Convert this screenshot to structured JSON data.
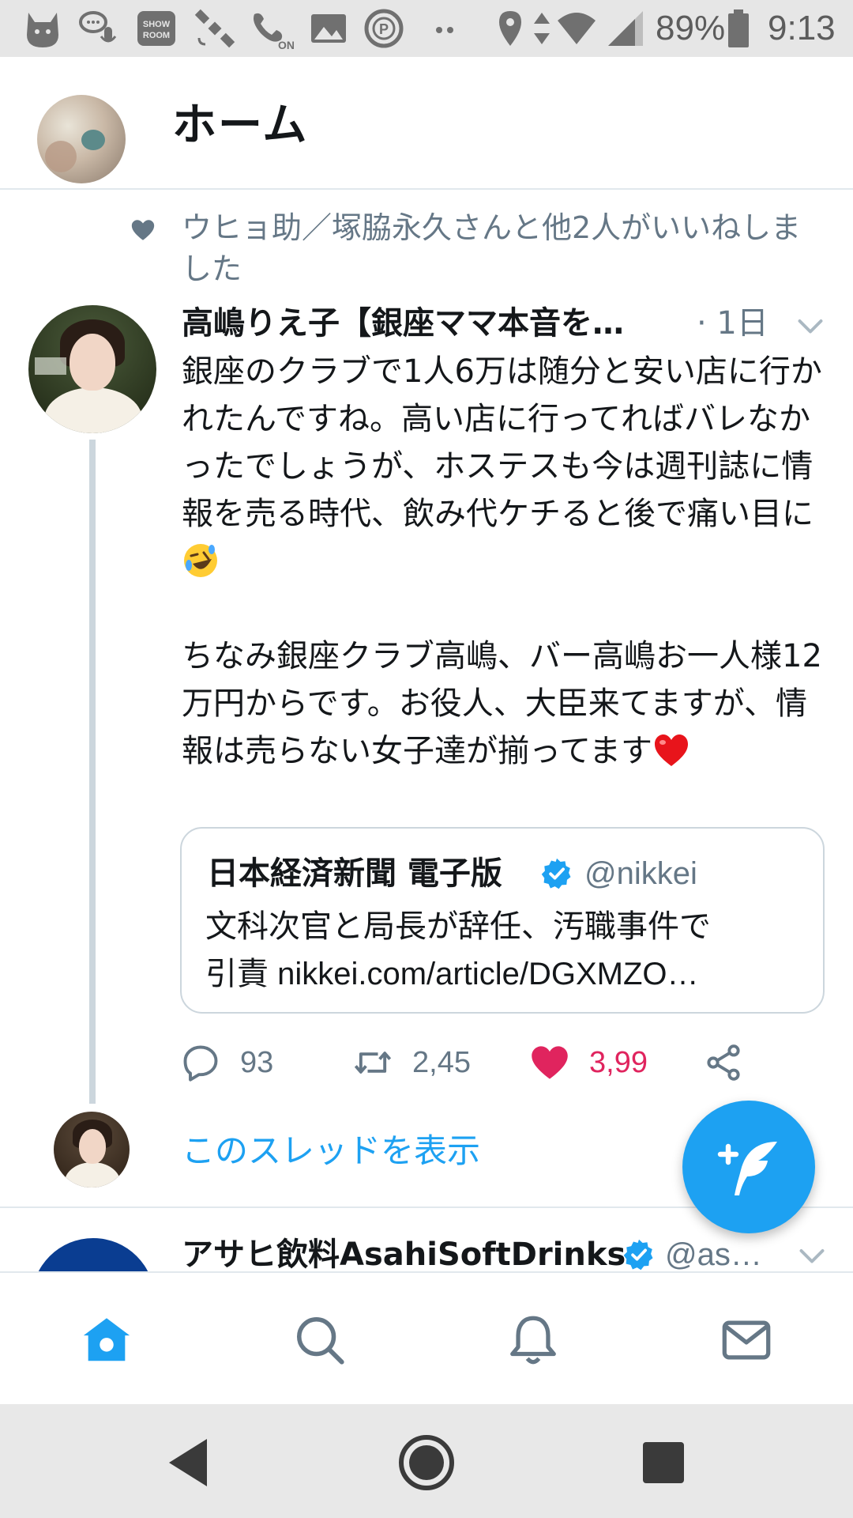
{
  "status_bar": {
    "battery": "89%",
    "time": "9:13",
    "notification_icons": [
      "cat-icon",
      "voice-message-icon",
      "showroom-icon",
      "satellite-icon",
      "wifi-calling-icon",
      "image-icon",
      "parking-icon",
      "more-dots-icon"
    ],
    "system_icons": [
      "location-icon",
      "data-arrows-icon",
      "wifi-icon",
      "signal-icon",
      "battery-icon"
    ],
    "showroom_label": "SHOW ROOM",
    "wifi_call_label": "ON"
  },
  "header": {
    "title": "ホーム"
  },
  "tweet": {
    "social_context": "ウヒョ助／塚脇永久さんと他2人がいいねしました",
    "author_name": "高嶋りえ子【銀座ママ本音を…",
    "time": "· 1日",
    "body_part1": "銀座のクラブで1人6万は随分と安い店に行かれたんですね。高い店に行ってればバレなかったでしょうが、ホステスも今は週刊誌に情報を売る時代、飲み代ケチると後で痛い目に",
    "body_part2": "\n\nちなみ銀座クラブ高嶋、バー高嶋お一人様12万円からです。お役人、大臣来てますが、情報は売らない女子達が揃ってます",
    "emoji_1": "rolling-on-floor-laughing-emoji",
    "emoji_2": "red-heart-emoji",
    "quote": {
      "name": "日本経済新聞 電子版",
      "handle": "@nikkei",
      "text_line1": "文科次官と局長が辞任、汚職事件で",
      "text_line2": "引責 nikkei.com/article/DGXMZO…"
    },
    "actions": {
      "replies": "93",
      "retweets": "2,45",
      "likes": "3,99"
    },
    "show_thread": "このスレッドを表示"
  },
  "next_tweet": {
    "author_name": "アサヒ飲料AsahiSoftDrinks",
    "handle": "@as…"
  },
  "tabs": [
    "home-icon",
    "search-icon",
    "notifications-icon",
    "messages-icon"
  ],
  "colors": {
    "accent": "#1da1f2",
    "like": "#e0245e",
    "muted": "#657786",
    "text": "#14171a"
  }
}
